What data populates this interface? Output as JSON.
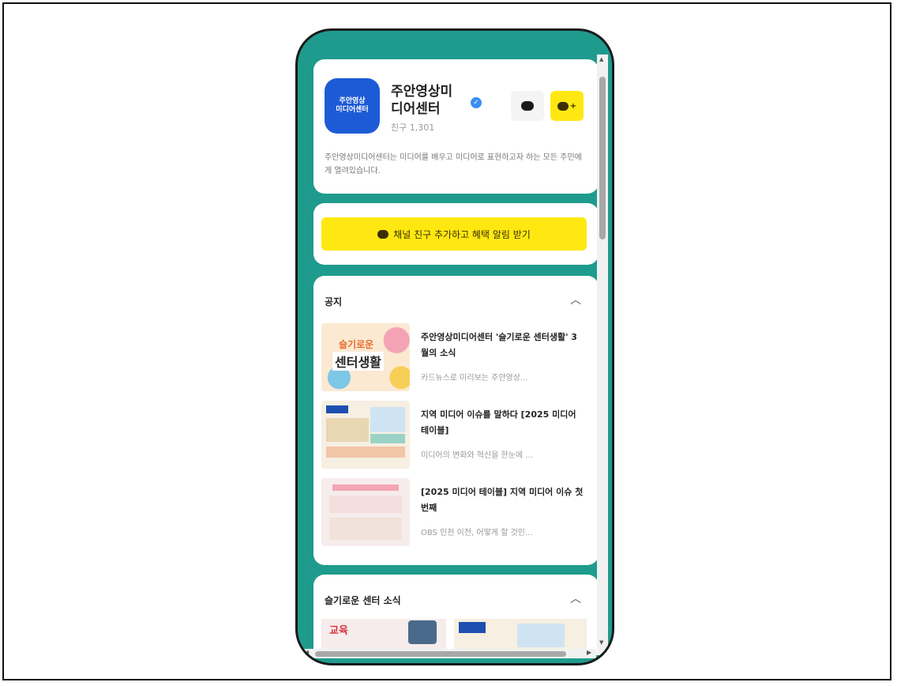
{
  "profile": {
    "logo_line1": "주안영상",
    "logo_line2": "미디어센터",
    "name_line1": "주안영상미",
    "name_line2": "디어센터",
    "verified_icon": "verified-check-icon",
    "friends": "친구 1,301",
    "chat_button_icon": "chat-bubble-icon",
    "add_button_icon": "add-channel-icon",
    "description": "주안영상미디어센터는 미디어를 배우고 미디어로 표현하고자 하는 모든 주민에게 열려있습니다."
  },
  "cta": {
    "label": "채널 친구 추가하고 혜택 알림 받기",
    "icon": "add-channel-icon",
    "color": "#ffe812"
  },
  "notice": {
    "title": "공지",
    "collapse_icon": "chevron-up-icon",
    "posts": [
      {
        "title": "주안영상미디어센터 '슬기로운 센터생활' 3월의 소식",
        "subtitle": "카드뉴스로 미리보는 주안영상...",
        "thumb_text1": "슬기로운",
        "thumb_text2": "센터생활"
      },
      {
        "title": "지역 미디어 이슈를 말하다 [2025 미디어 테이블]",
        "subtitle": "미디어의 변화와 혁신을 한눈에 ..."
      },
      {
        "title": "[2025 미디어 테이블] 지역 미디어 이슈 첫 번째",
        "subtitle": "OBS 인천 이전, 어떻게 할 것인..."
      }
    ]
  },
  "news": {
    "title": "슬기로운 센터 소식",
    "collapse_icon": "chevron-up-icon",
    "thumb1_text": "교육"
  },
  "colors": {
    "phone_bg": "#1f9b8e",
    "logo_bg": "#1d5bd6",
    "accent_yellow": "#ffe812"
  }
}
